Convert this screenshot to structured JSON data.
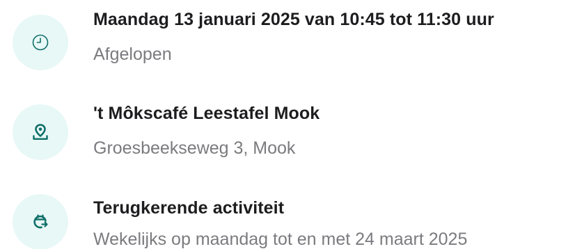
{
  "theme": {
    "icon_bg": "#e8f8f7",
    "icon_color": "#0f6f68",
    "title_color": "#1d1d1f",
    "subtitle_color": "#7b7b7f"
  },
  "details": [
    {
      "icon": "clock-icon",
      "title": "Maandag 13 januari 2025 van 10:45 tot 11:30 uur",
      "subtitle": "Afgelopen"
    },
    {
      "icon": "location-pin-icon",
      "title": "'t Môkscafé Leestafel Mook",
      "subtitle": "Groesbeekseweg 3, Mook"
    },
    {
      "icon": "recurring-calendar-icon",
      "title": "Terugkerende activiteit",
      "subtitle": "Wekelijks op maandag tot en met 24 maart 2025"
    }
  ]
}
